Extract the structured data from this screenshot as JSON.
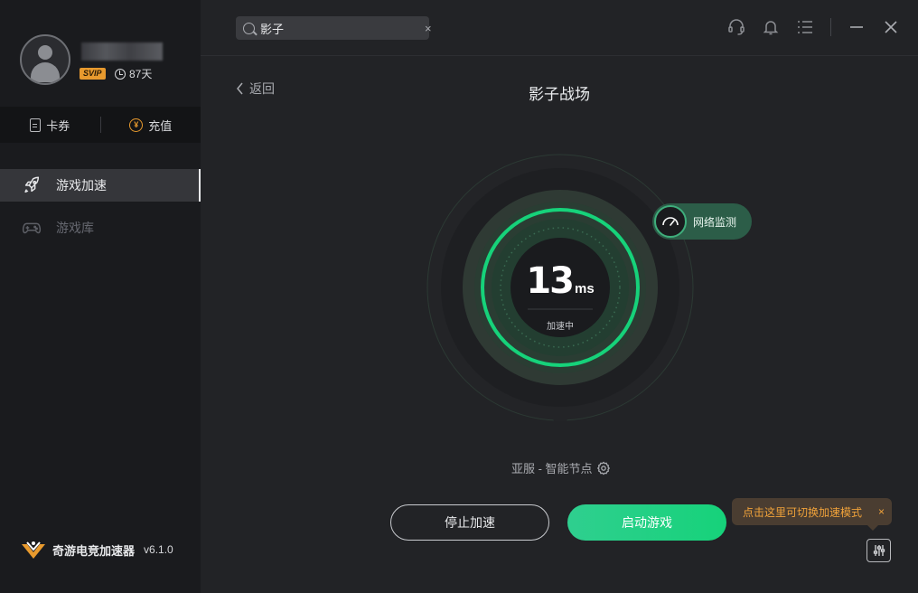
{
  "user": {
    "badge": "SVIP",
    "days": "87天"
  },
  "wallet": {
    "coupon_label": "卡券",
    "recharge_label": "充值"
  },
  "sidebar": {
    "items": [
      {
        "label": "游戏加速",
        "icon": "rocket-icon",
        "active": true
      },
      {
        "label": "游戏库",
        "icon": "gamepad-icon",
        "active": false
      }
    ]
  },
  "brand": {
    "name": "奇游电竞加速器",
    "version": "v6.1.0"
  },
  "search": {
    "value": "影子",
    "clear": "×"
  },
  "main": {
    "back_label": "返回",
    "title": "影子战场",
    "ping_value": "13",
    "ping_unit": "ms",
    "status": "加速中",
    "monitor_label": "网络监测",
    "node_label": "亚服 - 智能节点",
    "stop_label": "停止加速",
    "start_label": "启动游戏",
    "tip": "点击这里可切换加速模式",
    "tip_close": "×"
  },
  "colors": {
    "accent_green": "#16d27a",
    "tip_orange": "#f0a23a",
    "svip_gold": "#e89a2e"
  }
}
